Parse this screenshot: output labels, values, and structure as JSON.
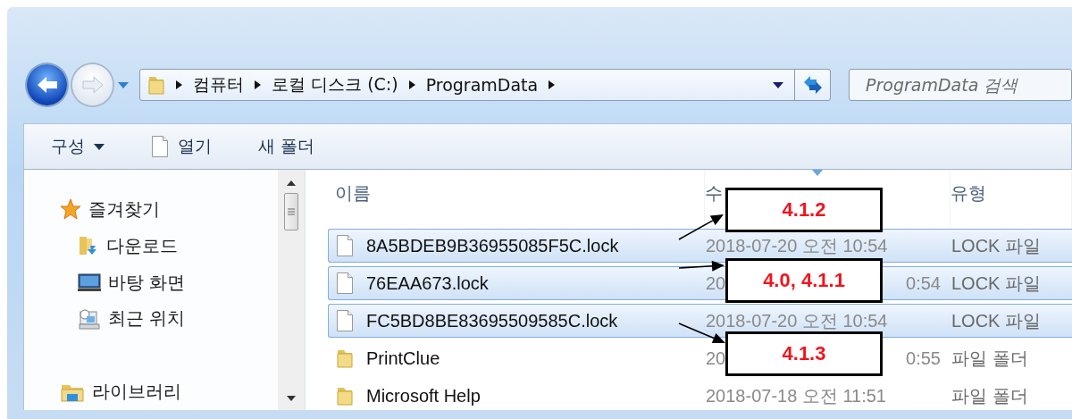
{
  "navigation": {
    "breadcrumbs": [
      "컴퓨터",
      "로컬 디스크 (C:)",
      "ProgramData"
    ],
    "search": {
      "placeholder": "ProgramData 검색"
    }
  },
  "toolbar": {
    "buttons": [
      {
        "label": "구성",
        "kind": "menu"
      },
      {
        "label": "열기",
        "kind": "file"
      },
      {
        "label": "새 폴더",
        "kind": "plain"
      }
    ]
  },
  "sidebar": {
    "items": [
      {
        "label": "즐겨찾기",
        "kind": "favorites",
        "children": [
          {
            "label": "다운로드",
            "kind": "downloads"
          },
          {
            "label": "바탕 화면",
            "kind": "desktop"
          },
          {
            "label": "최근 위치",
            "kind": "recent"
          }
        ]
      },
      {
        "label": "라이브러리",
        "kind": "library"
      }
    ]
  },
  "file_list": {
    "columns": [
      "이름",
      "수",
      "유형"
    ],
    "rows": [
      {
        "name": "8A5BDEB9B36955085F5C.lock",
        "kind": "file",
        "selected": true,
        "modified": [
          "2018-07-20 오전 10:54"
        ],
        "type": "LOCK 파일"
      },
      {
        "name": "76EAA673.lock",
        "kind": "file",
        "selected": true,
        "modified": [
          "20",
          "0:54"
        ],
        "type": "LOCK 파일"
      },
      {
        "name": "FC5BD8BE83695509585C.lock",
        "kind": "file",
        "selected": true,
        "modified": [
          "2018-07-20 오전 10:54"
        ],
        "type": "LOCK 파일"
      },
      {
        "name": "PrintClue",
        "kind": "folder",
        "selected": false,
        "modified": [
          "20",
          "0:55"
        ],
        "type": "파일 폴더"
      },
      {
        "name": "Microsoft Help",
        "kind": "folder",
        "selected": false,
        "modified": [
          "2018-07-18 오전 11:51"
        ],
        "type": "파일 폴더"
      }
    ]
  },
  "callouts": [
    {
      "label": "4.1.2"
    },
    {
      "label": "4.0, 4.1.1"
    },
    {
      "label": "4.1.3"
    }
  ]
}
